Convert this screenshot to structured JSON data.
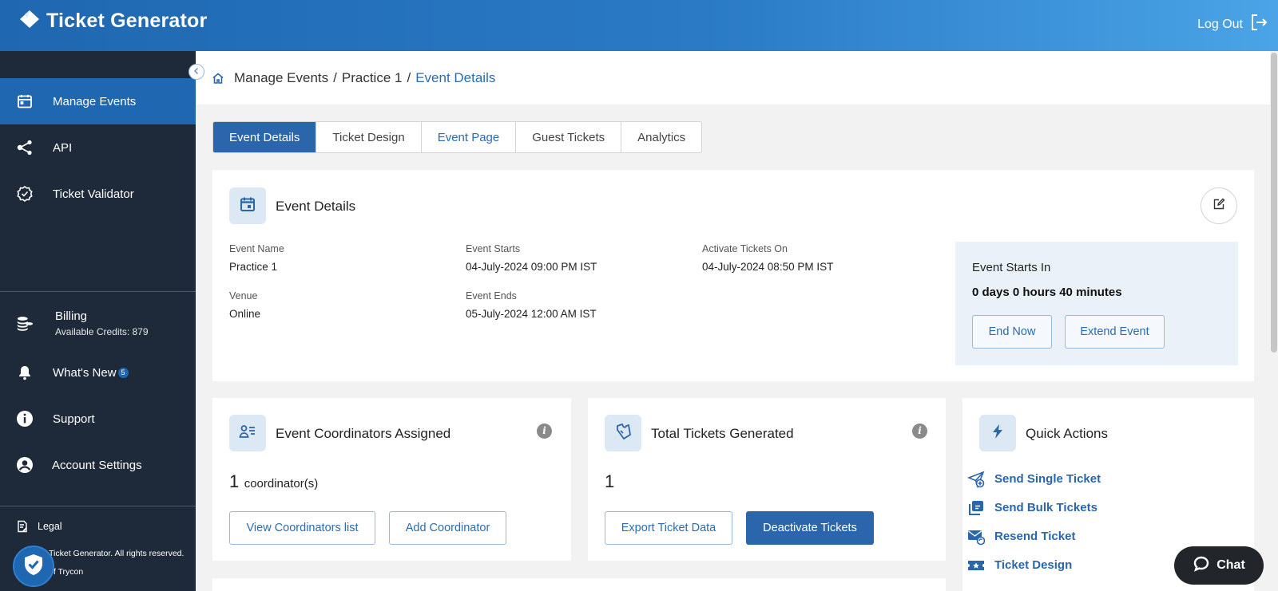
{
  "header": {
    "brand": "Ticket Generator",
    "logout_label": "Log Out"
  },
  "sidebar": {
    "items": [
      {
        "label": "Manage Events",
        "icon": "calendar-icon",
        "active": true
      },
      {
        "label": "API",
        "icon": "share-nodes-icon"
      },
      {
        "label": "Ticket Validator",
        "icon": "badge-check-icon"
      }
    ],
    "billing": {
      "label": "Billing",
      "sub": "Available Credits: 879"
    },
    "whats_new": {
      "label": "What's New",
      "badge": "5"
    },
    "support": {
      "label": "Support"
    },
    "account_settings": {
      "label": "Account Settings"
    },
    "legal": {
      "label": "Legal"
    },
    "footer_line1": "Ticket Generator. All rights reserved.",
    "footer_line2": "of Trycon"
  },
  "breadcrumb": {
    "items": [
      "Manage Events",
      "Practice 1"
    ],
    "separator": "/",
    "current": "Event Details"
  },
  "tabs": [
    {
      "label": "Event Details",
      "state": "active"
    },
    {
      "label": "Ticket Design",
      "state": "normal"
    },
    {
      "label": "Event Page",
      "state": "link"
    },
    {
      "label": "Guest Tickets",
      "state": "normal"
    },
    {
      "label": "Analytics",
      "state": "normal"
    }
  ],
  "event_details": {
    "title": "Event Details",
    "event_name_label": "Event Name",
    "event_name": "Practice 1",
    "venue_label": "Venue",
    "venue": "Online",
    "starts_label": "Event Starts",
    "starts": "04-July-2024 09:00 PM IST",
    "ends_label": "Event Ends",
    "ends": "05-July-2024 12:00 AM IST",
    "activate_label": "Activate Tickets On",
    "activate": "04-July-2024 08:50 PM IST",
    "countdown_title": "Event Starts In",
    "countdown_value": "0 days 0 hours 40 minutes",
    "end_now_label": "End Now",
    "extend_label": "Extend Event"
  },
  "coordinators": {
    "title": "Event Coordinators Assigned",
    "count": "1",
    "unit": "coordinator(s)",
    "view_label": "View Coordinators list",
    "add_label": "Add Coordinator"
  },
  "tickets": {
    "title": "Total Tickets Generated",
    "count": "1",
    "export_label": "Export Ticket Data",
    "deactivate_label": "Deactivate Tickets"
  },
  "quick_actions": {
    "title": "Quick Actions",
    "items": [
      {
        "label": "Send Single Ticket",
        "icon": "send-icon"
      },
      {
        "label": "Send Bulk Tickets",
        "icon": "stack-icon"
      },
      {
        "label": "Resend Ticket",
        "icon": "mail-refresh-icon"
      },
      {
        "label": "Ticket Design",
        "icon": "ticket-icon"
      }
    ]
  },
  "chat": {
    "label": "Chat"
  },
  "colors": {
    "primary": "#2b66ad",
    "sidebar": "#1e2a3a",
    "header_start": "#1f67b0",
    "header_end": "#4aa4e6"
  }
}
